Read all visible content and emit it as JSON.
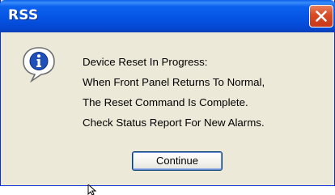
{
  "dialog": {
    "title": "RSS",
    "icon": "info-icon",
    "message_lines": [
      "Device Reset In Progress:",
      "When Front Panel Returns To Normal,",
      "The Reset Command Is Complete.",
      "Check Status Report For New Alarms."
    ],
    "continue_label": "Continue"
  },
  "colors": {
    "titlebar": "#0553e2",
    "close_button": "#d94a24",
    "dialog_background": "#ece9d8",
    "button_border": "#003c74"
  }
}
